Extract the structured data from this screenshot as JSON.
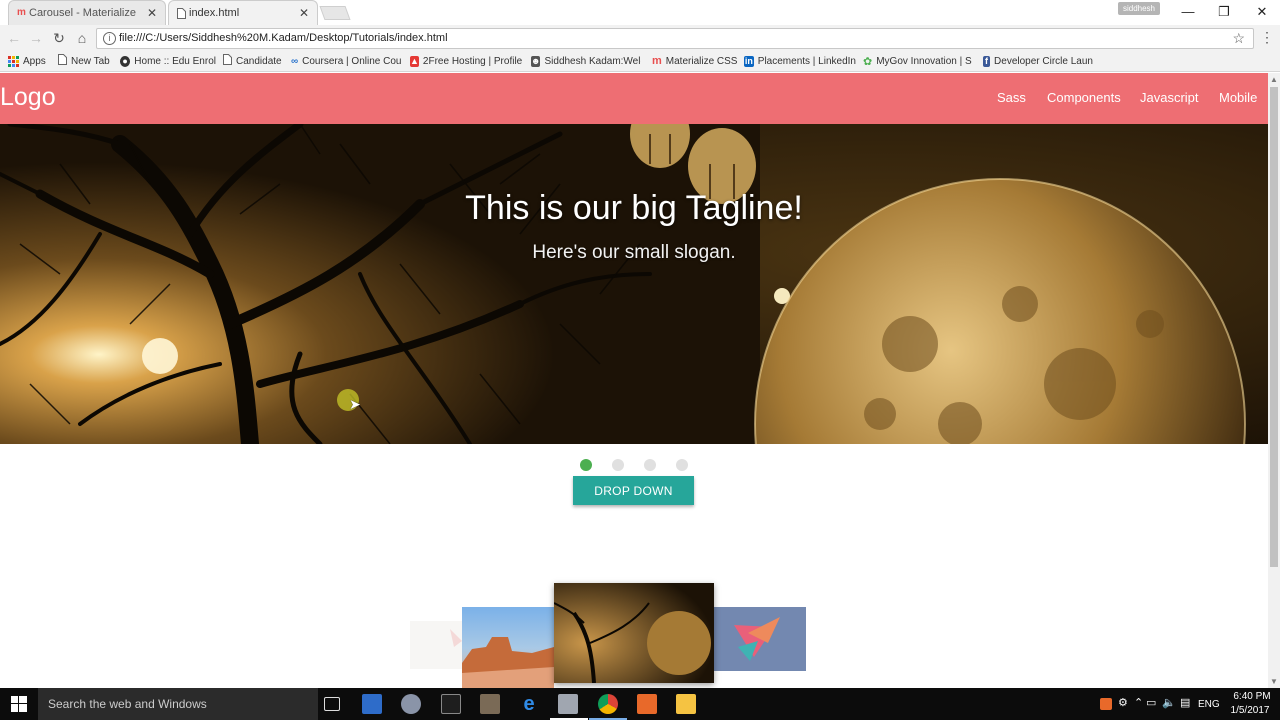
{
  "browser": {
    "tabs": [
      {
        "label": "Carousel - Materialize",
        "active": false,
        "icon": "materialize-icon"
      },
      {
        "label": "index.html",
        "active": true,
        "icon": "page-icon"
      }
    ],
    "user_badge": "siddhesh",
    "url": "file:///C:/Users/Siddhesh%20M.Kadam/Desktop/Tutorials/index.html",
    "bookmarks": [
      {
        "label": "Apps",
        "icon": "apps-icon"
      },
      {
        "label": "New Tab",
        "icon": "page-icon"
      },
      {
        "label": "Home :: Edu Enrol",
        "icon": "edu-icon"
      },
      {
        "label": "Candidate",
        "icon": "page-icon"
      },
      {
        "label": "Coursera | Online Cou",
        "icon": "coursera-icon"
      },
      {
        "label": "2Free Hosting | Profile",
        "icon": "hosting-icon"
      },
      {
        "label": "Siddhesh Kadam:Welc",
        "icon": "profile-icon"
      },
      {
        "label": "Materialize CSS",
        "icon": "materialize-icon"
      },
      {
        "label": "Placements | LinkedIn",
        "icon": "linkedin-icon"
      },
      {
        "label": "MyGov Innovation | S",
        "icon": "mygov-icon"
      },
      {
        "label": "Developer Circle Laun",
        "icon": "facebook-icon"
      }
    ]
  },
  "site": {
    "logo": "Logo",
    "nav": [
      "Sass",
      "Components",
      "Javascript",
      "Mobile"
    ],
    "colors": {
      "navbar": "#ee6e73",
      "button": "#26a69a",
      "indicator_active": "#4caf50"
    }
  },
  "hero": {
    "tagline": "This is our big Tagline!",
    "slogan": "Here's our small slogan."
  },
  "slider": {
    "indicator_count": 4,
    "active_indicator": 1
  },
  "dropdown_button": "DROP DOWN",
  "taskbar": {
    "search_placeholder": "Search the web and Windows",
    "language": "ENG",
    "time": "6:40 PM",
    "date": "1/5/2017"
  }
}
